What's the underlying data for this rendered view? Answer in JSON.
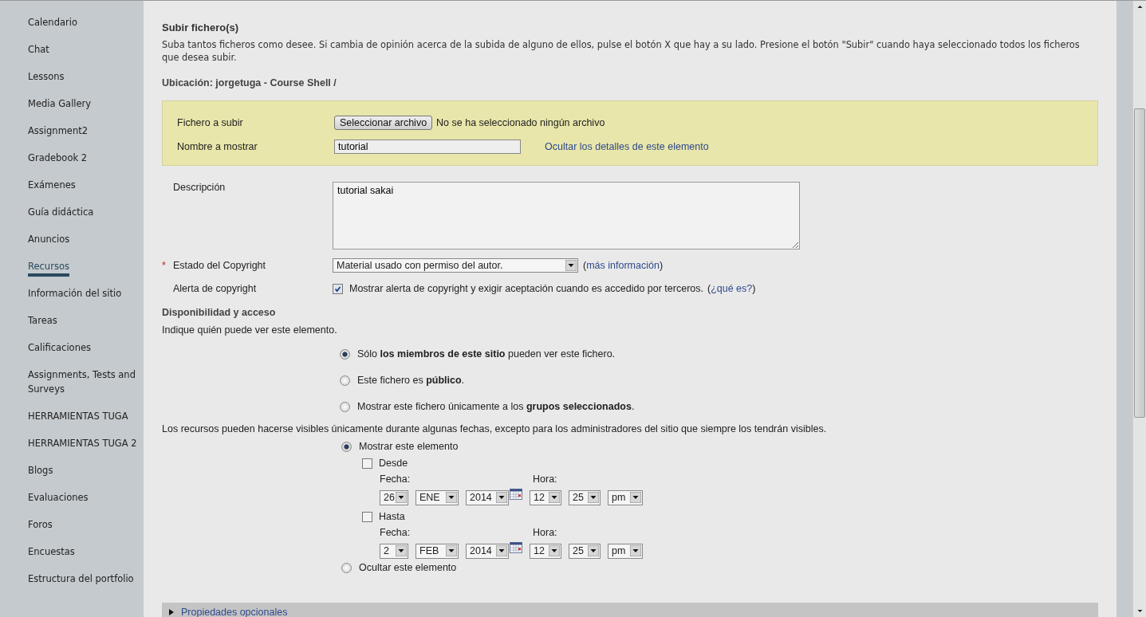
{
  "sidebar": {
    "items": [
      {
        "label": "Calendario",
        "selected": false
      },
      {
        "label": "Chat",
        "selected": false
      },
      {
        "label": "Lessons",
        "selected": false
      },
      {
        "label": "Media Gallery",
        "selected": false
      },
      {
        "label": "Assignment2",
        "selected": false
      },
      {
        "label": "Gradebook 2",
        "selected": false
      },
      {
        "label": "Exámenes",
        "selected": false
      },
      {
        "label": "Guía didáctica",
        "selected": false
      },
      {
        "label": "Anuncios",
        "selected": false
      },
      {
        "label": "Recursos",
        "selected": true
      },
      {
        "label": "Información del sitio",
        "selected": false
      },
      {
        "label": "Tareas",
        "selected": false
      },
      {
        "label": "Calificaciones",
        "selected": false
      },
      {
        "label": "Assignments, Tests and Surveys",
        "selected": false
      },
      {
        "label": "HERRAMIENTAS TUGA",
        "selected": false
      },
      {
        "label": "HERRAMIENTAS TUGA 2",
        "selected": false
      },
      {
        "label": "Blogs",
        "selected": false
      },
      {
        "label": "Evaluaciones",
        "selected": false
      },
      {
        "label": "Foros",
        "selected": false
      },
      {
        "label": "Encuestas",
        "selected": false
      },
      {
        "label": "Estructura del portfolio",
        "selected": false
      }
    ]
  },
  "header": {
    "title": "Subir fichero(s)",
    "description": "Suba tantos ficheros como desee. Si cambia de opinión acerca de la subida de alguno de ellos, pulse el botón X que hay a su lado. Presione el botón \"Subir\" cuando haya seleccionado todos los ficheros que desea subir.",
    "location": "Ubicación: jorgetuga - Course Shell /"
  },
  "upload": {
    "file_label": "Fichero a subir",
    "file_button": "Seleccionar archivo",
    "file_status": "No se ha seleccionado ningún archivo",
    "name_label": "Nombre a mostrar",
    "name_value": "tutorial",
    "hide_details_link": "Ocultar los detalles de este elemento"
  },
  "description": {
    "label": "Descripción",
    "value": "tutorial sakai"
  },
  "copyright": {
    "required_mark": "*",
    "label": "Estado del Copyright",
    "select_value": "Material usado con permiso del autor.",
    "link_prefix": "(",
    "link": "más información",
    "link_suffix": ")"
  },
  "alert": {
    "label": "Alerta de copyright",
    "checked": true,
    "text": "Mostrar alerta de copyright y exigir aceptación cuando es accedido por terceros.",
    "link_prefix": "(",
    "link": "¿qué es?",
    "link_suffix": ")"
  },
  "availability": {
    "title": "Disponibilidad y acceso",
    "hint": "Indique quién puede ver este elemento.",
    "options": [
      {
        "text": "Sólo **los miembros de este sitio** pueden ver este fichero.",
        "selected": true
      },
      {
        "text": "Este fichero es **público**.",
        "selected": false
      },
      {
        "text": "Mostrar este fichero únicamente a los **grupos seleccionados**.",
        "selected": false
      }
    ]
  },
  "visibility": {
    "note": "Los recursos pueden hacerse visibles únicamente durante algunas fechas, excepto para los administradores del sitio que siempre los tendrán visibles.",
    "show": {
      "label": "Mostrar este elemento",
      "selected": true
    },
    "ranges": [
      {
        "label": "Desde",
        "checked": false,
        "date_label": "Fecha:",
        "time_label": "Hora:",
        "day": "26",
        "month": "ENE",
        "year": "2014",
        "hour": "12",
        "minute": "25",
        "ampm": "pm"
      },
      {
        "label": "Hasta",
        "checked": false,
        "date_label": "Fecha:",
        "time_label": "Hora:",
        "day": "2",
        "month": "FEB",
        "year": "2014",
        "hour": "12",
        "minute": "25",
        "ampm": "pm"
      }
    ],
    "hide": {
      "label": "Ocultar este elemento",
      "selected": false
    }
  },
  "footer": {
    "label": "Propiedades opcionales",
    "expanded": false
  }
}
